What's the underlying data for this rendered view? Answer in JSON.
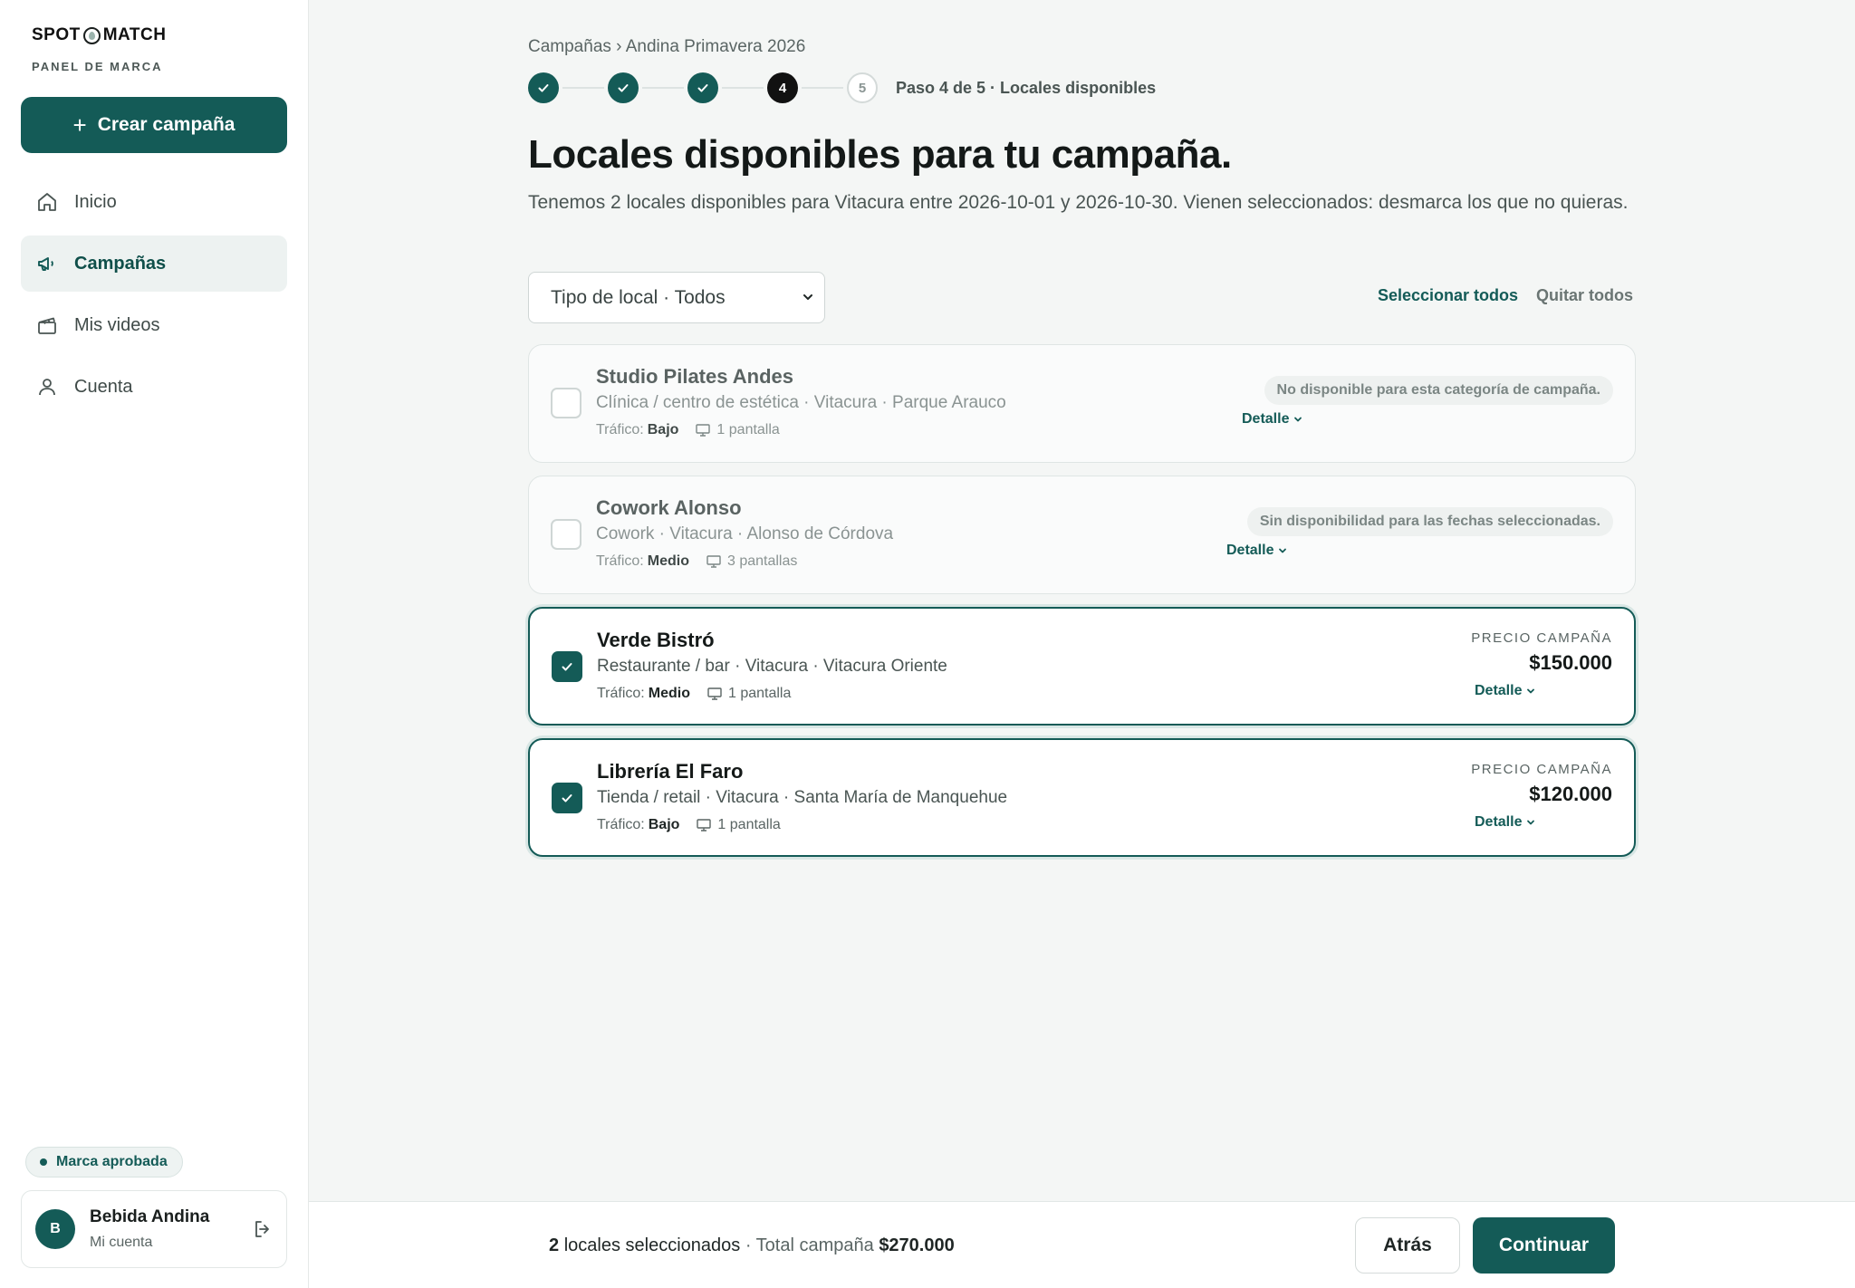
{
  "brand": {
    "logo_left": "SPOT",
    "logo_right": "MATCH",
    "panel_label": "PANEL DE MARCA"
  },
  "sidebar": {
    "create_button": "Crear campaña",
    "items": [
      {
        "label": "Inicio",
        "icon": "home-icon",
        "active": false
      },
      {
        "label": "Campañas",
        "icon": "megaphone-icon",
        "active": true
      },
      {
        "label": "Mis videos",
        "icon": "clapperboard-icon",
        "active": false
      },
      {
        "label": "Cuenta",
        "icon": "user-icon",
        "active": false
      }
    ],
    "status_badge": "Marca aprobada",
    "user": {
      "initial": "B",
      "name": "Bebida Andina",
      "subtitle": "Mi cuenta"
    }
  },
  "breadcrumb": "Campañas › Andina Primavera 2026",
  "stepper": {
    "current_step": 4,
    "total_steps": 5,
    "current_label": "4",
    "next_label": "5",
    "label": "Paso 4 de 5 · Locales disponibles"
  },
  "title": "Locales disponibles para tu campaña.",
  "description": "Tenemos 2 locales disponibles para Vitacura entre 2026-10-01 y 2026-10-30. Vienen seleccionados: desmarca los que no quieras.",
  "filter": {
    "value": "Tipo de local · Todos"
  },
  "actions": {
    "select_all": "Seleccionar todos",
    "deselect_all": "Quitar todos"
  },
  "venues": [
    {
      "name": "Studio Pilates Andes",
      "type": "Clínica / centro de estética · Vitacura · Parque Arauco",
      "traffic_label": "Tráfico:",
      "traffic": "Bajo",
      "screens": "1 pantalla",
      "checked": false,
      "available": false,
      "notice": "No disponible para esta categoría de campaña.",
      "detail": "Detalle"
    },
    {
      "name": "Cowork Alonso",
      "type": "Cowork · Vitacura · Alonso de Córdova",
      "traffic_label": "Tráfico:",
      "traffic": "Medio",
      "screens": "3 pantallas",
      "checked": false,
      "available": false,
      "notice": "Sin disponibilidad para las fechas seleccionadas.",
      "detail": "Detalle"
    },
    {
      "name": "Verde Bistró",
      "type": "Restaurante / bar · Vitacura · Vitacura Oriente",
      "traffic_label": "Tráfico:",
      "traffic": "Medio",
      "screens": "1 pantalla",
      "checked": true,
      "available": true,
      "price_label": "PRECIO CAMPAÑA",
      "price": "$150.000",
      "detail": "Detalle"
    },
    {
      "name": "Librería El Faro",
      "type": "Tienda / retail · Vitacura · Santa María de Manquehue",
      "traffic_label": "Tráfico:",
      "traffic": "Bajo",
      "screens": "1 pantalla",
      "checked": true,
      "available": true,
      "price_label": "PRECIO CAMPAÑA",
      "price": "$120.000",
      "detail": "Detalle"
    }
  ],
  "footer": {
    "selected_count": "2",
    "selected_text": "locales seleccionados",
    "total_label": "· Total campaña",
    "total": "$270.000",
    "back": "Atrás",
    "continue": "Continuar"
  },
  "colors": {
    "primary": "#145b57",
    "background": "#f4f6f5"
  }
}
